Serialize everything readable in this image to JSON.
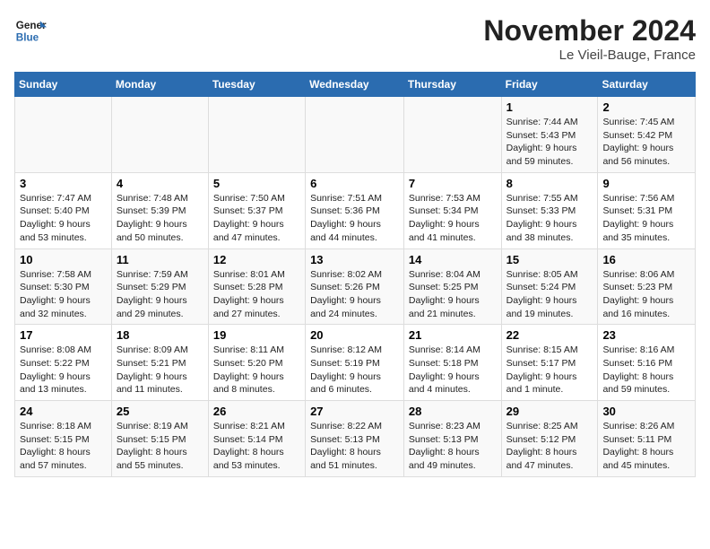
{
  "header": {
    "logo_line1": "General",
    "logo_line2": "Blue",
    "month": "November 2024",
    "location": "Le Vieil-Bauge, France"
  },
  "weekdays": [
    "Sunday",
    "Monday",
    "Tuesday",
    "Wednesday",
    "Thursday",
    "Friday",
    "Saturday"
  ],
  "weeks": [
    [
      {
        "day": "",
        "sunrise": "",
        "sunset": "",
        "daylight": ""
      },
      {
        "day": "",
        "sunrise": "",
        "sunset": "",
        "daylight": ""
      },
      {
        "day": "",
        "sunrise": "",
        "sunset": "",
        "daylight": ""
      },
      {
        "day": "",
        "sunrise": "",
        "sunset": "",
        "daylight": ""
      },
      {
        "day": "",
        "sunrise": "",
        "sunset": "",
        "daylight": ""
      },
      {
        "day": "1",
        "sunrise": "Sunrise: 7:44 AM",
        "sunset": "Sunset: 5:43 PM",
        "daylight": "Daylight: 9 hours and 59 minutes."
      },
      {
        "day": "2",
        "sunrise": "Sunrise: 7:45 AM",
        "sunset": "Sunset: 5:42 PM",
        "daylight": "Daylight: 9 hours and 56 minutes."
      }
    ],
    [
      {
        "day": "3",
        "sunrise": "Sunrise: 7:47 AM",
        "sunset": "Sunset: 5:40 PM",
        "daylight": "Daylight: 9 hours and 53 minutes."
      },
      {
        "day": "4",
        "sunrise": "Sunrise: 7:48 AM",
        "sunset": "Sunset: 5:39 PM",
        "daylight": "Daylight: 9 hours and 50 minutes."
      },
      {
        "day": "5",
        "sunrise": "Sunrise: 7:50 AM",
        "sunset": "Sunset: 5:37 PM",
        "daylight": "Daylight: 9 hours and 47 minutes."
      },
      {
        "day": "6",
        "sunrise": "Sunrise: 7:51 AM",
        "sunset": "Sunset: 5:36 PM",
        "daylight": "Daylight: 9 hours and 44 minutes."
      },
      {
        "day": "7",
        "sunrise": "Sunrise: 7:53 AM",
        "sunset": "Sunset: 5:34 PM",
        "daylight": "Daylight: 9 hours and 41 minutes."
      },
      {
        "day": "8",
        "sunrise": "Sunrise: 7:55 AM",
        "sunset": "Sunset: 5:33 PM",
        "daylight": "Daylight: 9 hours and 38 minutes."
      },
      {
        "day": "9",
        "sunrise": "Sunrise: 7:56 AM",
        "sunset": "Sunset: 5:31 PM",
        "daylight": "Daylight: 9 hours and 35 minutes."
      }
    ],
    [
      {
        "day": "10",
        "sunrise": "Sunrise: 7:58 AM",
        "sunset": "Sunset: 5:30 PM",
        "daylight": "Daylight: 9 hours and 32 minutes."
      },
      {
        "day": "11",
        "sunrise": "Sunrise: 7:59 AM",
        "sunset": "Sunset: 5:29 PM",
        "daylight": "Daylight: 9 hours and 29 minutes."
      },
      {
        "day": "12",
        "sunrise": "Sunrise: 8:01 AM",
        "sunset": "Sunset: 5:28 PM",
        "daylight": "Daylight: 9 hours and 27 minutes."
      },
      {
        "day": "13",
        "sunrise": "Sunrise: 8:02 AM",
        "sunset": "Sunset: 5:26 PM",
        "daylight": "Daylight: 9 hours and 24 minutes."
      },
      {
        "day": "14",
        "sunrise": "Sunrise: 8:04 AM",
        "sunset": "Sunset: 5:25 PM",
        "daylight": "Daylight: 9 hours and 21 minutes."
      },
      {
        "day": "15",
        "sunrise": "Sunrise: 8:05 AM",
        "sunset": "Sunset: 5:24 PM",
        "daylight": "Daylight: 9 hours and 19 minutes."
      },
      {
        "day": "16",
        "sunrise": "Sunrise: 8:06 AM",
        "sunset": "Sunset: 5:23 PM",
        "daylight": "Daylight: 9 hours and 16 minutes."
      }
    ],
    [
      {
        "day": "17",
        "sunrise": "Sunrise: 8:08 AM",
        "sunset": "Sunset: 5:22 PM",
        "daylight": "Daylight: 9 hours and 13 minutes."
      },
      {
        "day": "18",
        "sunrise": "Sunrise: 8:09 AM",
        "sunset": "Sunset: 5:21 PM",
        "daylight": "Daylight: 9 hours and 11 minutes."
      },
      {
        "day": "19",
        "sunrise": "Sunrise: 8:11 AM",
        "sunset": "Sunset: 5:20 PM",
        "daylight": "Daylight: 9 hours and 8 minutes."
      },
      {
        "day": "20",
        "sunrise": "Sunrise: 8:12 AM",
        "sunset": "Sunset: 5:19 PM",
        "daylight": "Daylight: 9 hours and 6 minutes."
      },
      {
        "day": "21",
        "sunrise": "Sunrise: 8:14 AM",
        "sunset": "Sunset: 5:18 PM",
        "daylight": "Daylight: 9 hours and 4 minutes."
      },
      {
        "day": "22",
        "sunrise": "Sunrise: 8:15 AM",
        "sunset": "Sunset: 5:17 PM",
        "daylight": "Daylight: 9 hours and 1 minute."
      },
      {
        "day": "23",
        "sunrise": "Sunrise: 8:16 AM",
        "sunset": "Sunset: 5:16 PM",
        "daylight": "Daylight: 8 hours and 59 minutes."
      }
    ],
    [
      {
        "day": "24",
        "sunrise": "Sunrise: 8:18 AM",
        "sunset": "Sunset: 5:15 PM",
        "daylight": "Daylight: 8 hours and 57 minutes."
      },
      {
        "day": "25",
        "sunrise": "Sunrise: 8:19 AM",
        "sunset": "Sunset: 5:15 PM",
        "daylight": "Daylight: 8 hours and 55 minutes."
      },
      {
        "day": "26",
        "sunrise": "Sunrise: 8:21 AM",
        "sunset": "Sunset: 5:14 PM",
        "daylight": "Daylight: 8 hours and 53 minutes."
      },
      {
        "day": "27",
        "sunrise": "Sunrise: 8:22 AM",
        "sunset": "Sunset: 5:13 PM",
        "daylight": "Daylight: 8 hours and 51 minutes."
      },
      {
        "day": "28",
        "sunrise": "Sunrise: 8:23 AM",
        "sunset": "Sunset: 5:13 PM",
        "daylight": "Daylight: 8 hours and 49 minutes."
      },
      {
        "day": "29",
        "sunrise": "Sunrise: 8:25 AM",
        "sunset": "Sunset: 5:12 PM",
        "daylight": "Daylight: 8 hours and 47 minutes."
      },
      {
        "day": "30",
        "sunrise": "Sunrise: 8:26 AM",
        "sunset": "Sunset: 5:11 PM",
        "daylight": "Daylight: 8 hours and 45 minutes."
      }
    ]
  ]
}
